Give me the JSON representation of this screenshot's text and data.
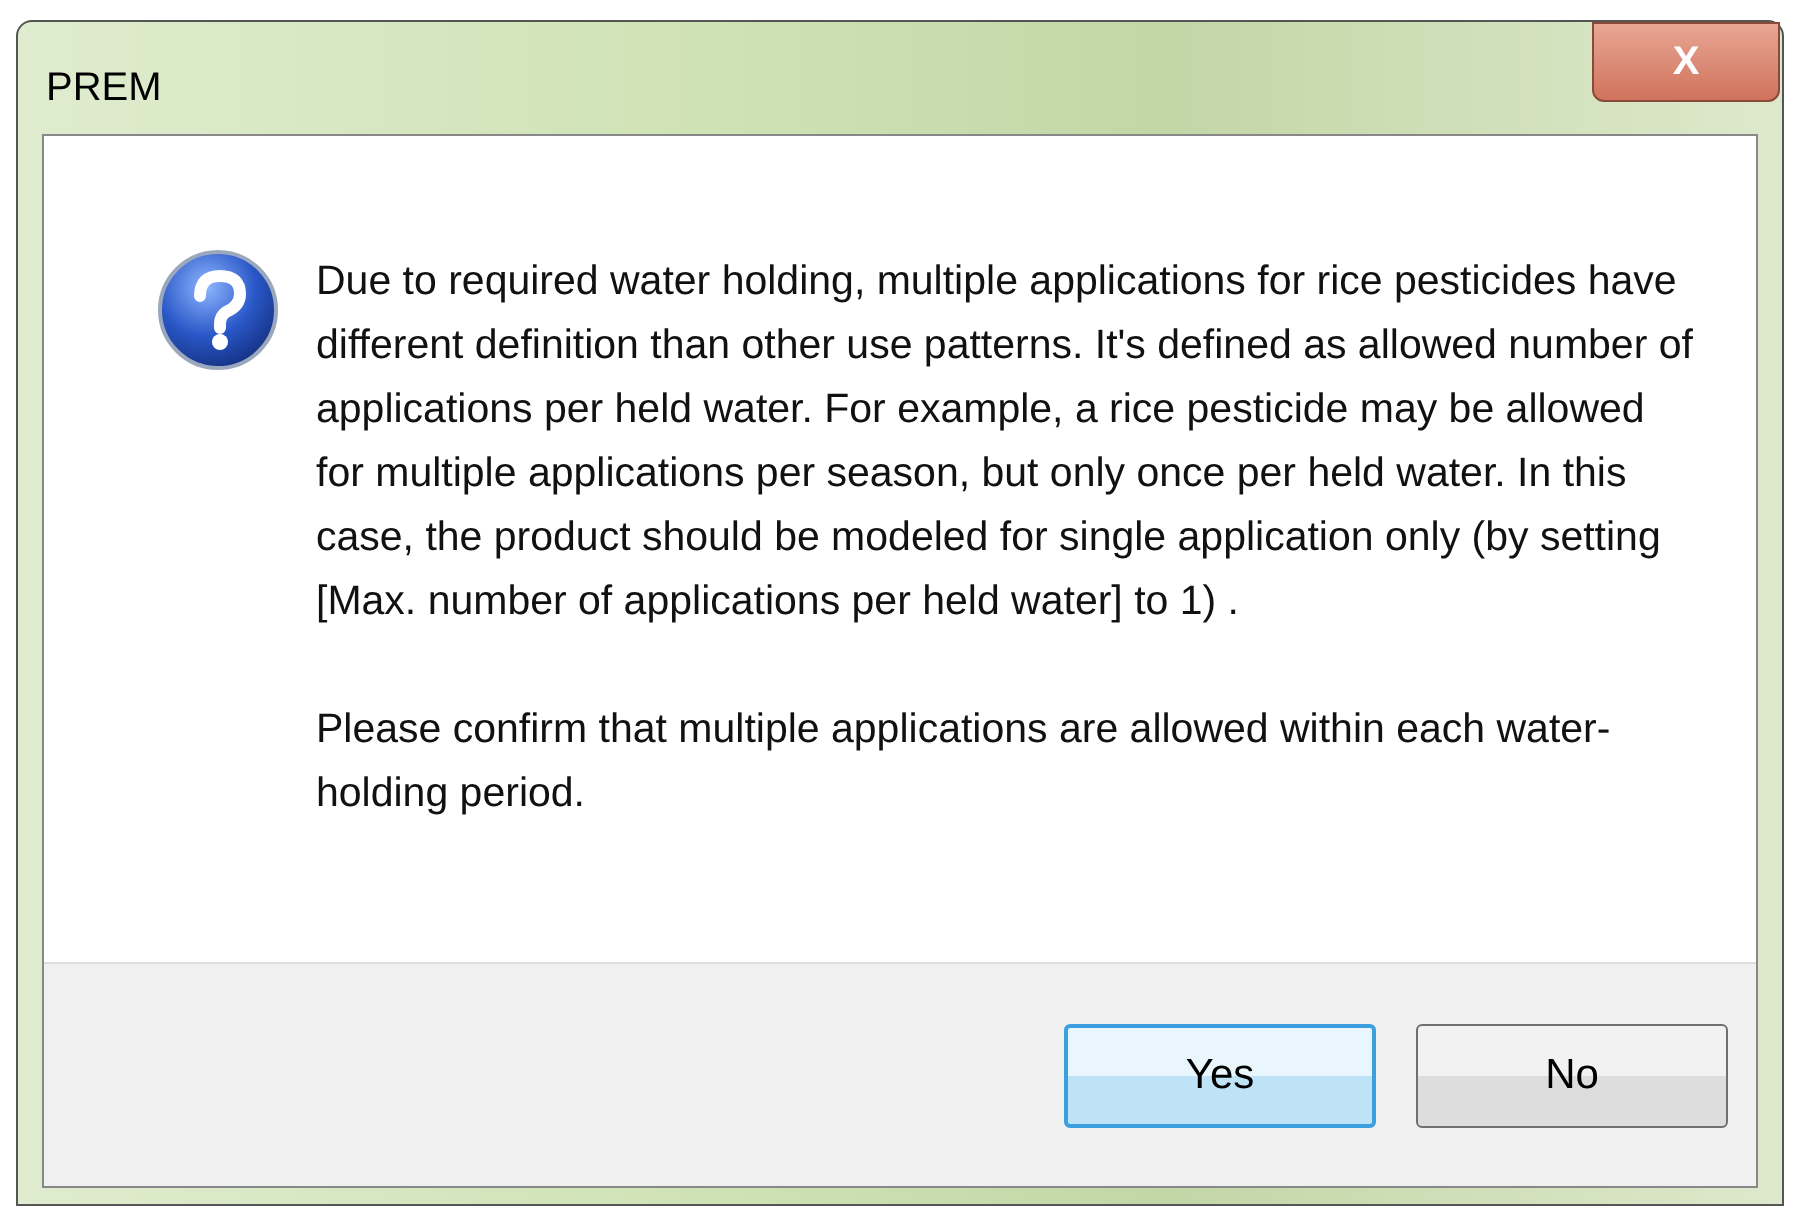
{
  "window": {
    "title": "PREM",
    "close_label": "X"
  },
  "message": {
    "paragraphs": [
      "Due to required water holding, multiple applications for rice pesticides have different definition than other use patterns. It's defined as allowed number of applications per held water. For example, a rice pesticide may be allowed for multiple applications per season, but only once per held water. In this case, the product should be modeled for single application only (by setting [Max. number of applications per held water] to 1) .",
      "Please confirm that multiple applications are allowed within each water-holding period."
    ]
  },
  "buttons": [
    {
      "label": "Yes",
      "default": true
    },
    {
      "label": "No",
      "default": false
    }
  ]
}
